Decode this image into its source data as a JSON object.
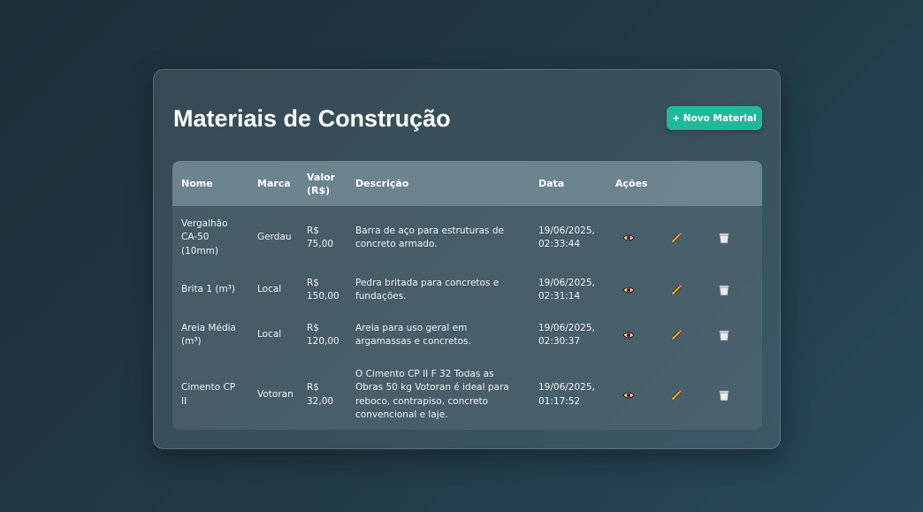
{
  "header": {
    "title": "Materiais de Construção",
    "new_button_label": "+ Novo Material"
  },
  "table": {
    "columns": [
      "Nome",
      "Marca",
      "Valor (R$)",
      "Descrição",
      "Data",
      "Ações"
    ],
    "rows": [
      {
        "nome": "Vergalhão CA-50 (10mm)",
        "marca": "Gerdau",
        "valor": "R$ 75,00",
        "descricao": "Barra de aço para estruturas de concreto armado.",
        "data": "19/06/2025, 02:33:44"
      },
      {
        "nome": "Brita 1 (m³)",
        "marca": "Local",
        "valor": "R$ 150,00",
        "descricao": "Pedra britada para concretos e fundações.",
        "data": "19/06/2025, 02:31:14"
      },
      {
        "nome": "Areia Média (m³)",
        "marca": "Local",
        "valor": "R$ 120,00",
        "descricao": "Areia para uso geral em argamassas e concretos.",
        "data": "19/06/2025, 02:30:37"
      },
      {
        "nome": "Cimento CP II",
        "marca": "Votoran",
        "valor": "R$ 32,00",
        "descricao": "O Cimento CP II F 32 Todas as Obras 50 kg Votoran é ideal para reboco, contrapiso, concreto convencional e laje.",
        "data": "19/06/2025, 01:17:52"
      }
    ]
  },
  "icons": {
    "view": "eye-icon",
    "edit": "pencil-icon",
    "delete": "trash-icon"
  },
  "colors": {
    "accent": "#1fb99a"
  }
}
